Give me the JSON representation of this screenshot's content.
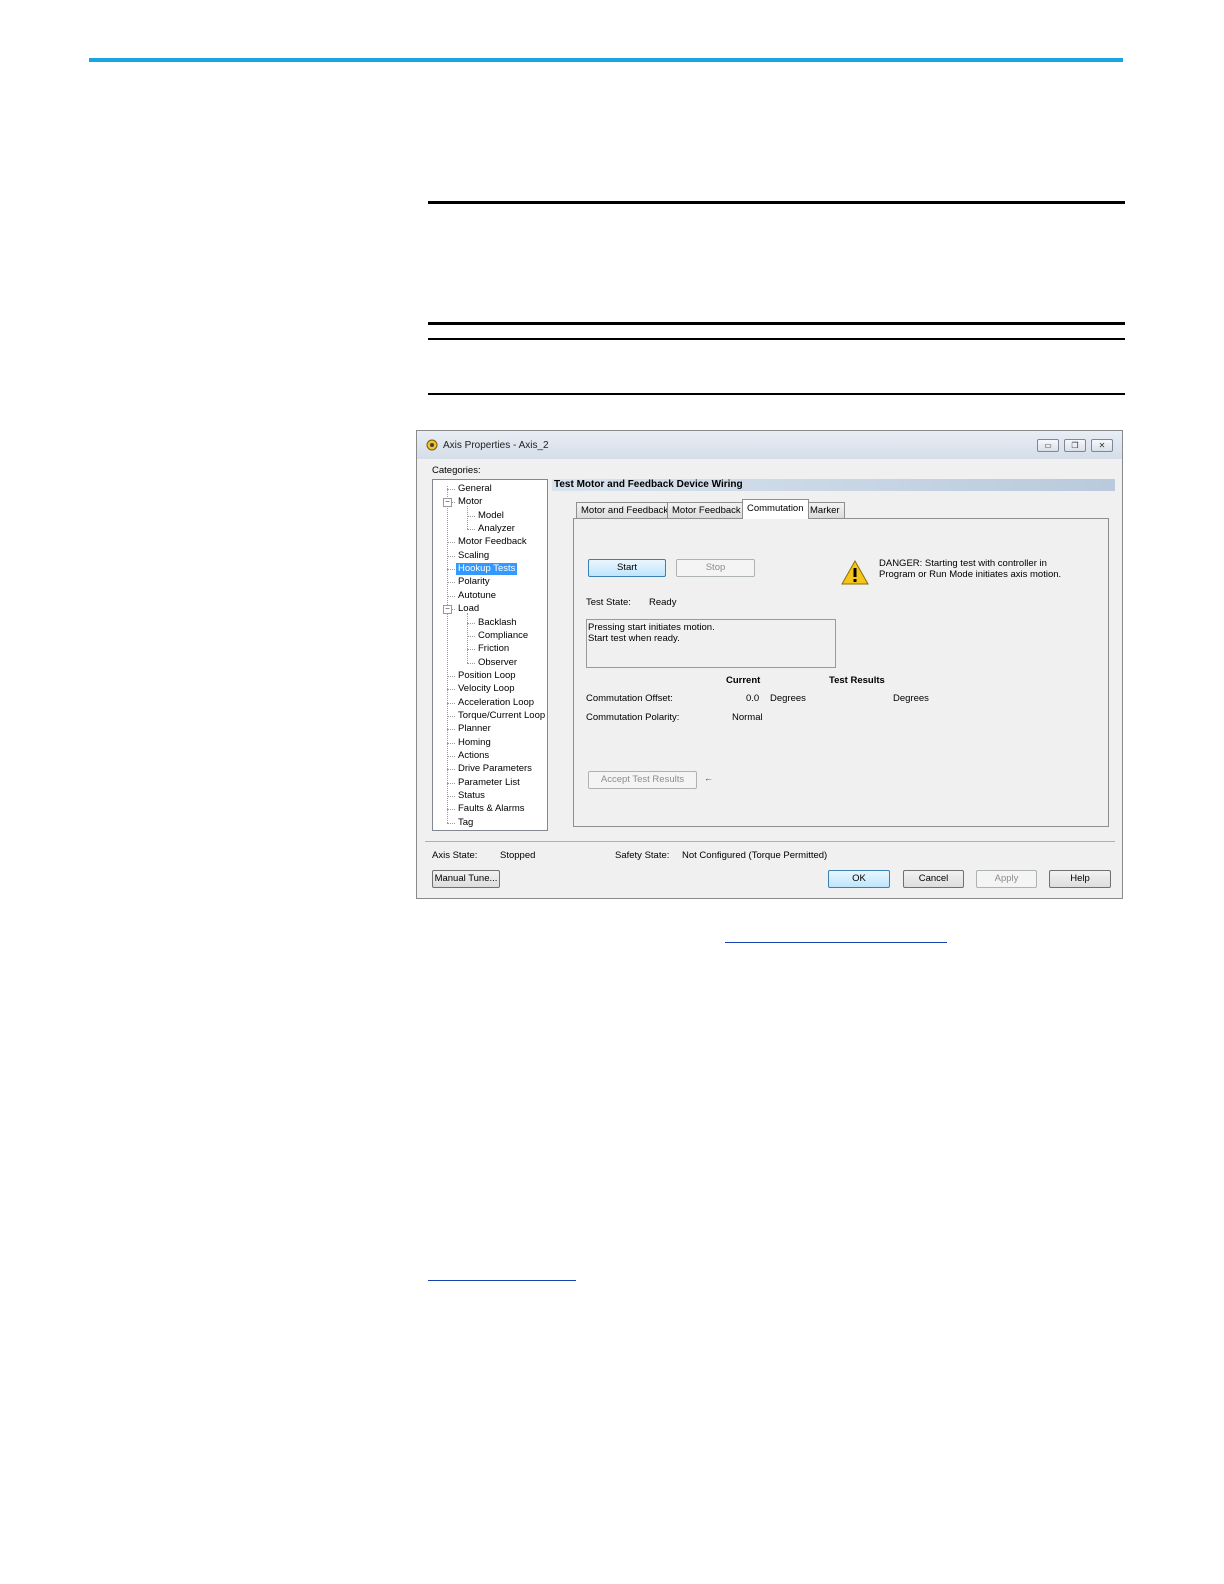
{
  "window": {
    "title": "Axis Properties - Axis_2",
    "controls": {
      "minimize": "▭",
      "restore": "❐",
      "close": "✕"
    }
  },
  "categories": {
    "label": "Categories:",
    "items": [
      {
        "label": "General"
      },
      {
        "label": "Motor",
        "expander": "−"
      },
      {
        "label": "Model"
      },
      {
        "label": "Analyzer"
      },
      {
        "label": "Motor Feedback"
      },
      {
        "label": "Scaling"
      },
      {
        "label": "Hookup Tests"
      },
      {
        "label": "Polarity"
      },
      {
        "label": "Autotune"
      },
      {
        "label": "Load",
        "expander": "−"
      },
      {
        "label": "Backlash"
      },
      {
        "label": "Compliance"
      },
      {
        "label": "Friction"
      },
      {
        "label": "Observer"
      },
      {
        "label": "Position Loop"
      },
      {
        "label": "Velocity Loop"
      },
      {
        "label": "Acceleration Loop"
      },
      {
        "label": "Torque/Current Loop"
      },
      {
        "label": "Planner"
      },
      {
        "label": "Homing"
      },
      {
        "label": "Actions"
      },
      {
        "label": "Drive Parameters"
      },
      {
        "label": "Parameter List"
      },
      {
        "label": "Status"
      },
      {
        "label": "Faults & Alarms"
      },
      {
        "label": "Tag"
      }
    ]
  },
  "section_title": "Test Motor and Feedback Device Wiring",
  "tabs": [
    "Motor and Feedback",
    "Motor Feedback",
    "Commutation",
    "Marker"
  ],
  "test": {
    "start": "Start",
    "stop": "Stop",
    "danger": "DANGER: Starting test with controller in\nProgram or Run Mode initiates axis motion.",
    "state_label": "Test State:",
    "state_value": "Ready",
    "message": "Pressing start initiates motion.\nStart test when ready.",
    "col_current": "Current",
    "col_results": "Test Results",
    "offset_label": "Commutation Offset:",
    "offset_value": "0.0",
    "offset_unit": "Degrees",
    "offset_result_unit": "Degrees",
    "polarity_label": "Commutation Polarity:",
    "polarity_value": "Normal",
    "accept": "Accept Test Results",
    "accept_arrow": "←"
  },
  "footer": {
    "axis_state_label": "Axis State:",
    "axis_state_value": "Stopped",
    "safety_state_label": "Safety State:",
    "safety_state_value": "Not Configured (Torque Permitted)",
    "manual_tune": "Manual Tune...",
    "ok": "OK",
    "cancel": "Cancel",
    "apply": "Apply",
    "help": "Help"
  },
  "colors": {
    "accent_rule": "#1aa4e0",
    "selection": "#3399ff"
  }
}
